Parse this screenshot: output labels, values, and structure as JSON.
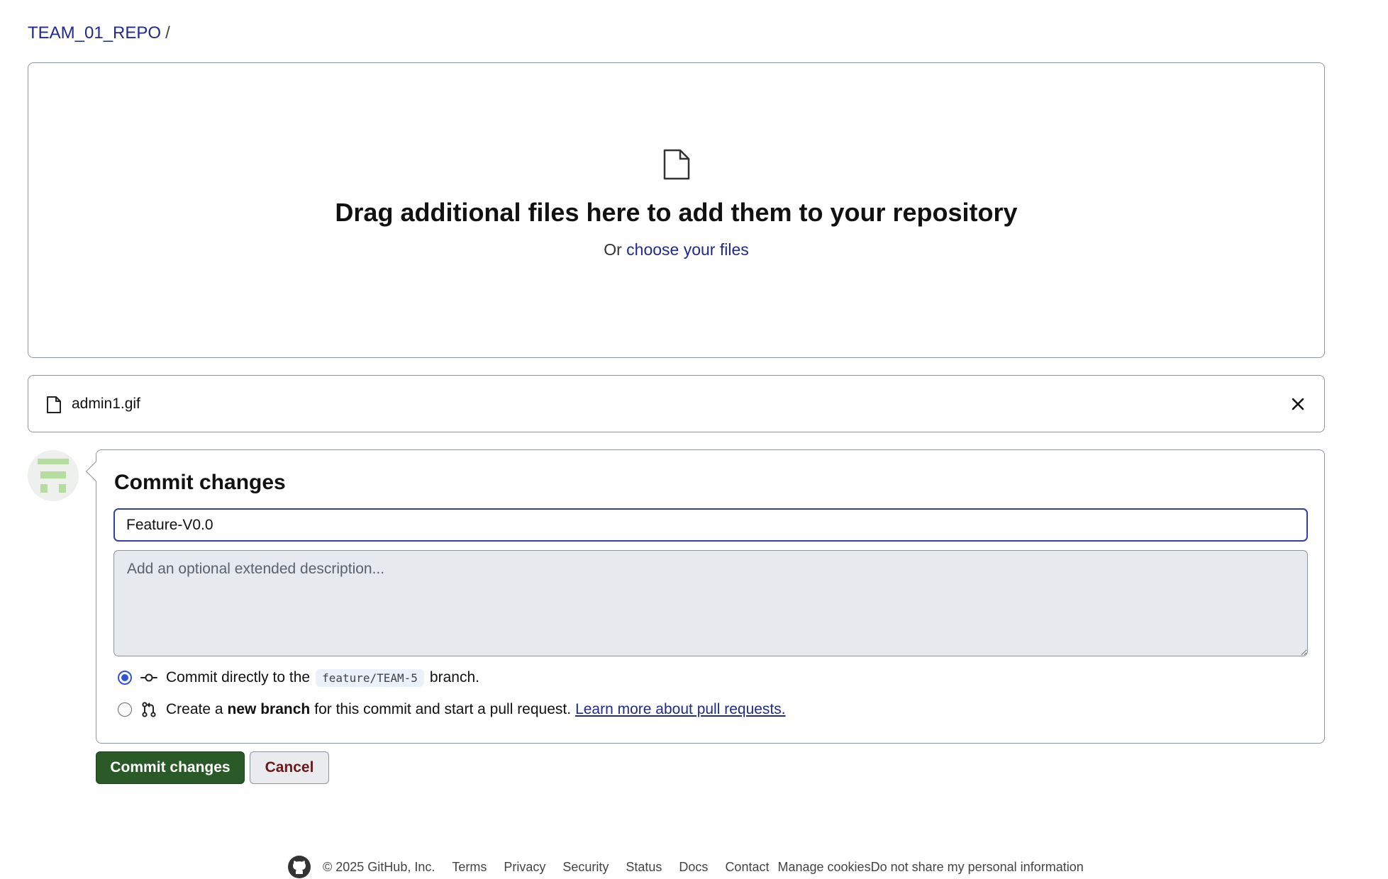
{
  "breadcrumb": {
    "repo": "TEAM_01_REPO",
    "separator": "/"
  },
  "dropzone": {
    "title": "Drag additional files here to add them to your repository",
    "prefix": "Or",
    "choose_link": "choose your files",
    "icon": "file-icon"
  },
  "files": [
    {
      "name": "admin1.gif",
      "icon": "file-icon",
      "remove_icon": "close-icon"
    }
  ],
  "commit": {
    "heading": "Commit changes",
    "summary_value": "Feature-V0.0",
    "description_placeholder": "Add an optional extended description...",
    "options": [
      {
        "selected": true,
        "icon": "git-commit-icon",
        "text_before": "Commit directly to the",
        "branch": "feature/TEAM-5",
        "text_after": "branch."
      },
      {
        "selected": false,
        "icon": "git-pull-request-icon",
        "text_before": "Create a",
        "bold": "new branch",
        "text_after": "for this commit and start a pull request.",
        "link": "Learn more about pull requests."
      }
    ],
    "commit_button": "Commit changes",
    "cancel_button": "Cancel"
  },
  "footer": {
    "copyright": "© 2025 GitHub, Inc.",
    "links": [
      "Terms",
      "Privacy",
      "Security",
      "Status",
      "Docs",
      "Contact",
      "Manage cookies",
      "Do not share my personal information"
    ]
  },
  "colors": {
    "link": "#1f2a8a",
    "focus_border": "#3340a6",
    "primary_button": "#2b5a29",
    "radio_selected": "#3056d3"
  }
}
